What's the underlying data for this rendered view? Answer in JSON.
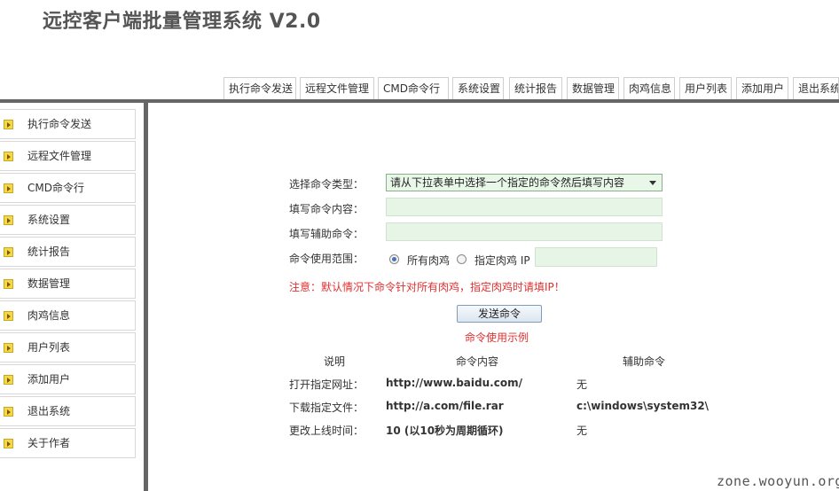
{
  "app_title": "远控客户端批量管理系统 V2.0",
  "top_nav": [
    {
      "label": "执行命令发送"
    },
    {
      "label": "远程文件管理"
    },
    {
      "label": "CMD命令行"
    },
    {
      "label": "系统设置"
    },
    {
      "label": "统计报告"
    },
    {
      "label": "数据管理"
    },
    {
      "label": "肉鸡信息"
    },
    {
      "label": "用户列表"
    },
    {
      "label": "添加用户"
    },
    {
      "label": "退出系统"
    }
  ],
  "sidebar": {
    "items": [
      {
        "label": "执行命令发送"
      },
      {
        "label": "远程文件管理"
      },
      {
        "label": "CMD命令行"
      },
      {
        "label": "系统设置"
      },
      {
        "label": "统计报告"
      },
      {
        "label": "数据管理"
      },
      {
        "label": "肉鸡信息"
      },
      {
        "label": "用户列表"
      },
      {
        "label": "添加用户"
      },
      {
        "label": "退出系统"
      },
      {
        "label": "关于作者"
      }
    ]
  },
  "form": {
    "command_type_label": "选择命令类型：",
    "command_type_selected": "请从下拉表单中选择一个指定的命令然后填写内容",
    "command_content_label": "填写命令内容：",
    "command_content_value": "",
    "aux_command_label": "填写辅助命令：",
    "aux_command_value": "",
    "scope_label": "命令使用范围：",
    "scope_all_label": "所有肉鸡",
    "scope_ip_label": "指定肉鸡 IP",
    "ip_value": "",
    "notice": "注意：默认情况下命令针对所有肉鸡，指定肉鸡时请填IP！",
    "send_button": "发送命令"
  },
  "examples": {
    "title": "命令使用示例",
    "headers": [
      "说明",
      "命令内容",
      "辅助命令"
    ],
    "rows": [
      [
        "打开指定网址：",
        "http://www.baidu.com/",
        "无"
      ],
      [
        "下载指定文件：",
        "http://a.com/file.rar",
        "c:\\windows\\system32\\"
      ],
      [
        "更改上线时间：",
        "10 (以10秒为周期循环)",
        "无"
      ]
    ]
  },
  "watermark": "zone.wooyun.org",
  "colors": {
    "warning_red": "#e03030",
    "input_green": "#e6f5e6",
    "divider_gray": "#666666",
    "bullet_yellow": "#f5d84a"
  }
}
